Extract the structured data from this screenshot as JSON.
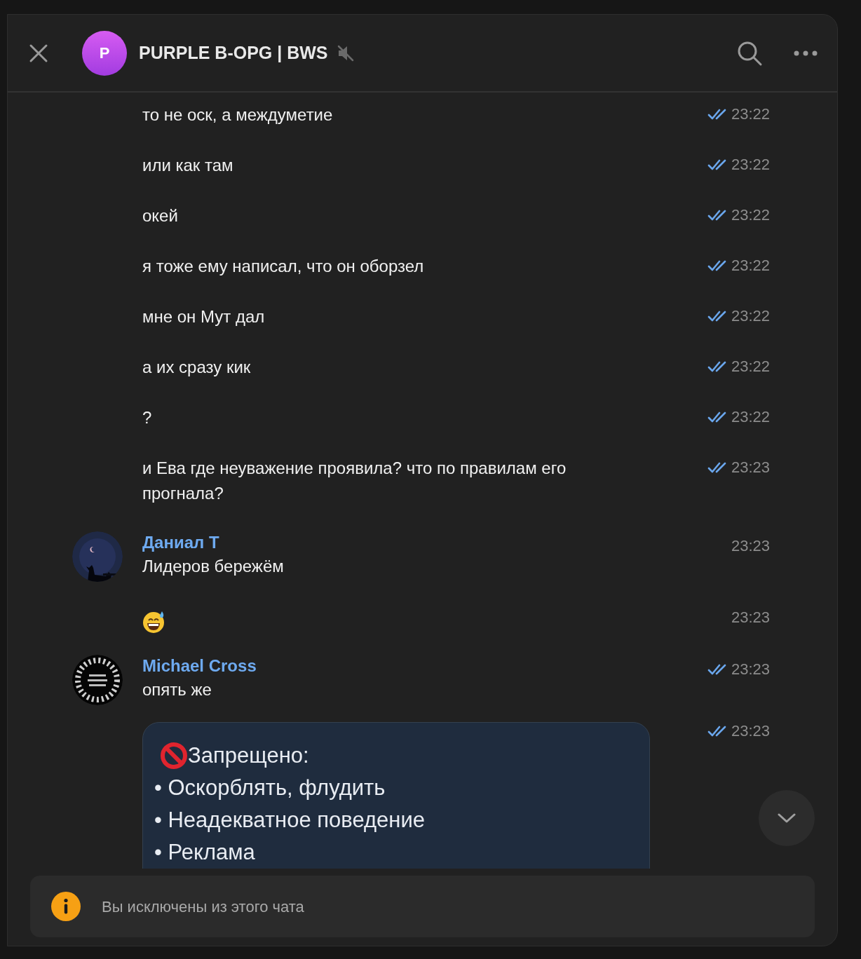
{
  "chat": {
    "title": "PURPLE B-OPG | BWS",
    "avatar_letter": "P",
    "muted": true
  },
  "messages": [
    {
      "kind": "text",
      "text": "то не оск, а междуметие",
      "time": "23:22",
      "read": true
    },
    {
      "kind": "text",
      "text": "или как там",
      "time": "23:22",
      "read": true
    },
    {
      "kind": "text",
      "text": "окей",
      "time": "23:22",
      "read": true
    },
    {
      "kind": "text",
      "text": "я тоже ему написал, что он оборзел",
      "time": "23:22",
      "read": true
    },
    {
      "kind": "text",
      "text": "мне он Мут дал",
      "time": "23:22",
      "read": true
    },
    {
      "kind": "text",
      "text": "а их сразу кик",
      "time": "23:22",
      "read": true
    },
    {
      "kind": "text",
      "text": "?",
      "time": "23:22",
      "read": true
    },
    {
      "kind": "text",
      "text": "и Ева где неуважение проявила? что по правилам его прогнала?",
      "time": "23:23",
      "read": true
    },
    {
      "kind": "text",
      "sender": "Даниал Т",
      "text": "Лидеров бережём",
      "time": "23:23",
      "read": false
    },
    {
      "kind": "emoji",
      "time": "23:23",
      "read": false
    },
    {
      "kind": "text",
      "sender": "Michael Cross",
      "text": "опять же",
      "time": "23:23",
      "read": true
    },
    {
      "lines": [
        "Запрещено:",
        "• Оскорблять, флудить",
        "• Неадекватное поведение",
        "• Реклама"
      ],
      "time": "23:23",
      "read": true
    }
  ],
  "notice": "Вы исключены из этого чата"
}
